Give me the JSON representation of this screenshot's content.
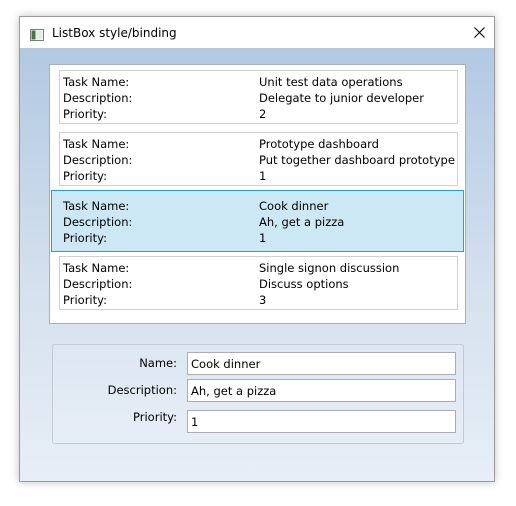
{
  "window": {
    "title": "ListBox style/binding"
  },
  "list": {
    "label_task_name": "Task Name:",
    "label_description": "Description:",
    "label_priority": "Priority:",
    "items": [
      {
        "task_name": "Unit test data operations",
        "description": "Delegate to junior developer",
        "priority": "2",
        "selected": false
      },
      {
        "task_name": "Prototype dashboard",
        "description": "Put together dashboard prototype",
        "priority": "1",
        "selected": false
      },
      {
        "task_name": "Cook dinner",
        "description": "Ah, get a pizza",
        "priority": "1",
        "selected": true
      },
      {
        "task_name": "Single signon discussion",
        "description": "Discuss options",
        "priority": "3",
        "selected": false
      }
    ]
  },
  "details": {
    "name_label": "Name:",
    "name_value": "Cook dinner",
    "description_label": "Description:",
    "description_value": "Ah, get a pizza",
    "priority_label": "Priority:",
    "priority_value": "1"
  },
  "colors": {
    "selection_fill": "#cce8f5",
    "selection_border": "#26a0da",
    "client_gradient_top": "#b1c9e2",
    "client_gradient_bottom": "#e7eef7"
  },
  "icons": {
    "app": "window-app-icon",
    "close": "close-icon"
  }
}
